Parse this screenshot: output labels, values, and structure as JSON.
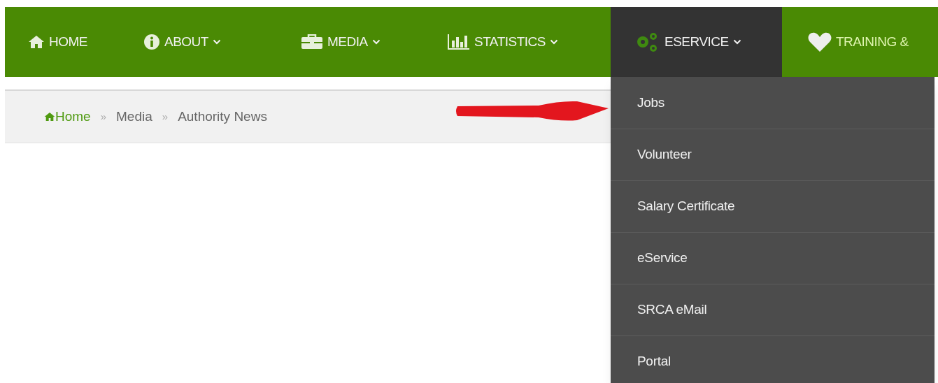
{
  "nav": {
    "items": [
      {
        "label": "HOME",
        "dropdown": false,
        "selected": false
      },
      {
        "label": "ABOUT",
        "dropdown": true,
        "selected": false
      },
      {
        "label": "MEDIA",
        "dropdown": true,
        "selected": false
      },
      {
        "label": "STATISTICS",
        "dropdown": true,
        "selected": false
      },
      {
        "label": "ESERVICE",
        "dropdown": true,
        "selected": true
      },
      {
        "label": "TRAINING &",
        "dropdown": false,
        "selected": false
      }
    ]
  },
  "breadcrumb": [
    {
      "kind": "link",
      "label": "Home"
    },
    {
      "kind": "separator",
      "label": "»"
    },
    {
      "kind": "link",
      "label": "Media"
    },
    {
      "kind": "separator",
      "label": "»"
    },
    {
      "kind": "current",
      "label": "Authority News"
    }
  ],
  "dropdown_menu": {
    "items": [
      "Jobs",
      "Volunteer",
      "Salary Certificate",
      "eService",
      "SRCA eMail",
      "Portal"
    ]
  }
}
